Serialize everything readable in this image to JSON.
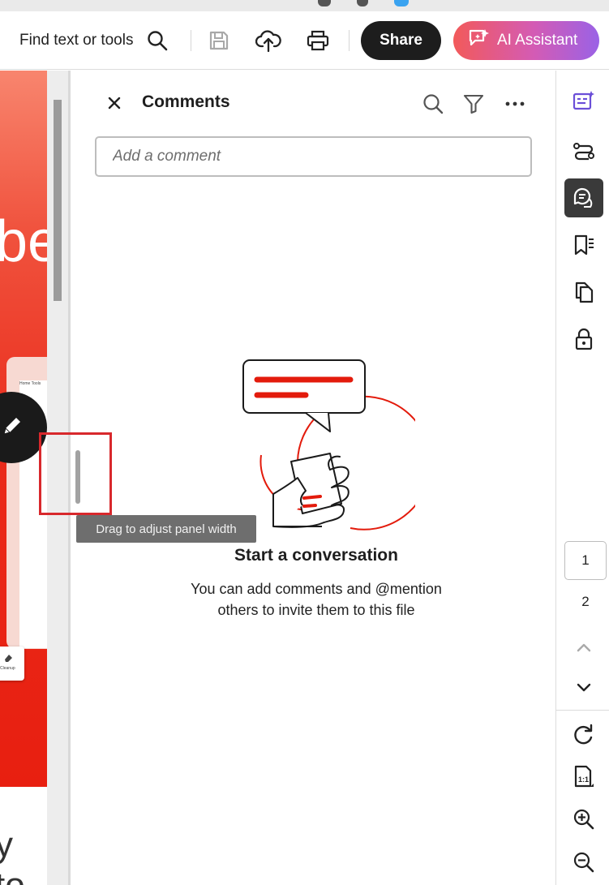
{
  "toolbar": {
    "find_label": "Find text or tools",
    "share_label": "Share",
    "ai_label": "AI Assistant"
  },
  "document": {
    "heading_fragment": "be",
    "footer_fragment": "y to",
    "mini_toolbar_text": "Home  Tools",
    "bottom_card_label": "Cleanup"
  },
  "resize": {
    "tooltip": "Drag to adjust panel width"
  },
  "comments": {
    "title": "Comments",
    "input_placeholder": "Add a comment",
    "empty_title": "Start a conversation",
    "empty_line1": "You can add comments and @mention",
    "empty_line2": "others to invite them to this file"
  },
  "rail": {
    "current_page": "1",
    "next_page": "2"
  },
  "colors": {
    "accent_purple": "#6b4fd8",
    "share_bg": "#1d1d1d",
    "illustration_red": "#e31b0c",
    "highlight_border": "#d8282c"
  }
}
